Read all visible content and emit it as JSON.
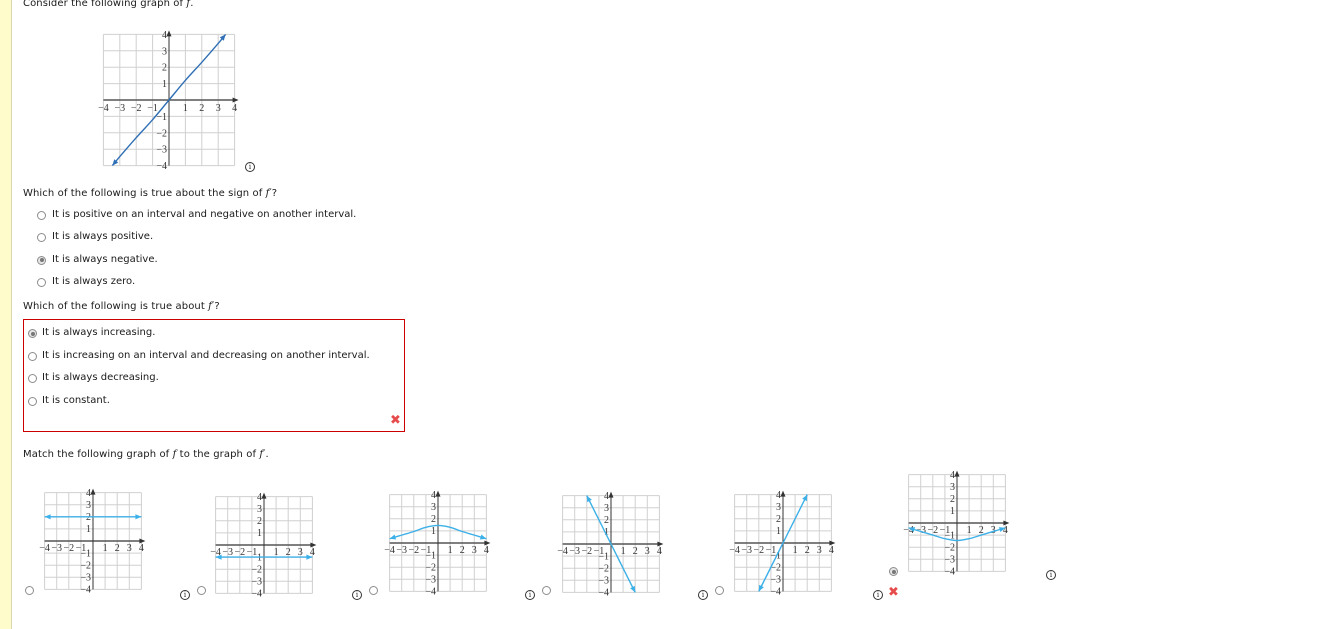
{
  "intro": {
    "prefix": "Consider the following graph of ",
    "var": "f",
    "suffix": "."
  },
  "main_graph": {
    "function_name": "f",
    "curve_color": "#2f6fb5",
    "x_ticks": [
      "-4",
      "-3",
      "-2",
      "-1",
      "1",
      "2",
      "3",
      "4"
    ],
    "y_ticks": [
      "4",
      "3",
      "2",
      "1",
      "-1",
      "-2",
      "-3",
      "-4"
    ],
    "curve": [
      [
        -3.45,
        -4
      ],
      [
        -3,
        -3.45
      ],
      [
        -2,
        -2.3
      ],
      [
        -1,
        -1.2
      ],
      [
        0,
        0
      ],
      [
        1,
        1.2
      ],
      [
        2,
        2.3
      ],
      [
        3,
        3.45
      ],
      [
        3.45,
        4
      ]
    ]
  },
  "q1": {
    "prompt_prefix": "Which of the following is true about the sign of ",
    "prompt_var": "f′",
    "prompt_suffix": "?",
    "options": [
      {
        "label": "It is positive on an interval and negative on another interval.",
        "selected": false
      },
      {
        "label": "It is always positive.",
        "selected": false
      },
      {
        "label": "It is always negative.",
        "selected": true
      },
      {
        "label": "It is always zero.",
        "selected": false
      }
    ]
  },
  "q2": {
    "prompt_prefix": "Which of the following is true about ",
    "prompt_var": "f′",
    "prompt_suffix": "?",
    "options": [
      {
        "label": "It is always increasing.",
        "selected": true
      },
      {
        "label": "It is increasing on an interval and decreasing on another interval.",
        "selected": false
      },
      {
        "label": "It is always decreasing.",
        "selected": false
      },
      {
        "label": "It is constant.",
        "selected": false
      }
    ],
    "status": "incorrect",
    "status_icon": "✖"
  },
  "q3": {
    "prompt_prefix": "Match the following graph of ",
    "prompt_var1": "f",
    "prompt_mid": " to the graph of ",
    "prompt_var2": "f′",
    "prompt_suffix": ".",
    "curve_color": "#3cb0e8",
    "choices": [
      {
        "kind": "line",
        "points": [
          [
            -4,
            2
          ],
          [
            4,
            2
          ]
        ],
        "selected": false
      },
      {
        "kind": "line",
        "points": [
          [
            -4,
            -1
          ],
          [
            4,
            -1
          ]
        ],
        "selected": false
      },
      {
        "kind": "curve",
        "points": [
          [
            -4,
            0.35
          ],
          [
            -3,
            0.65
          ],
          [
            -2,
            0.95
          ],
          [
            -1,
            1.3
          ],
          [
            0,
            1.45
          ],
          [
            1,
            1.3
          ],
          [
            2,
            0.95
          ],
          [
            3,
            0.65
          ],
          [
            4,
            0.35
          ]
        ],
        "selected": false
      },
      {
        "kind": "line",
        "points": [
          [
            -2,
            4
          ],
          [
            2,
            -4
          ]
        ],
        "selected": false
      },
      {
        "kind": "line",
        "points": [
          [
            -2,
            -4
          ],
          [
            2,
            4
          ]
        ],
        "selected": false
      },
      {
        "kind": "curve",
        "points": [
          [
            -4,
            -0.4
          ],
          [
            -3,
            -0.7
          ],
          [
            -2,
            -1
          ],
          [
            -1,
            -1.3
          ],
          [
            0,
            -1.45
          ],
          [
            1,
            -1.3
          ],
          [
            2,
            -1
          ],
          [
            3,
            -0.7
          ],
          [
            4,
            -0.4
          ]
        ],
        "selected": true,
        "status": "incorrect"
      }
    ],
    "x_ticks": [
      "-4",
      "-3",
      "-2",
      "-1",
      "1",
      "2",
      "3",
      "4"
    ],
    "y_ticks": [
      "4",
      "3",
      "2",
      "1",
      "-1",
      "-2",
      "-3",
      "-4"
    ]
  },
  "icons": {
    "info": "i",
    "x": "✖"
  }
}
